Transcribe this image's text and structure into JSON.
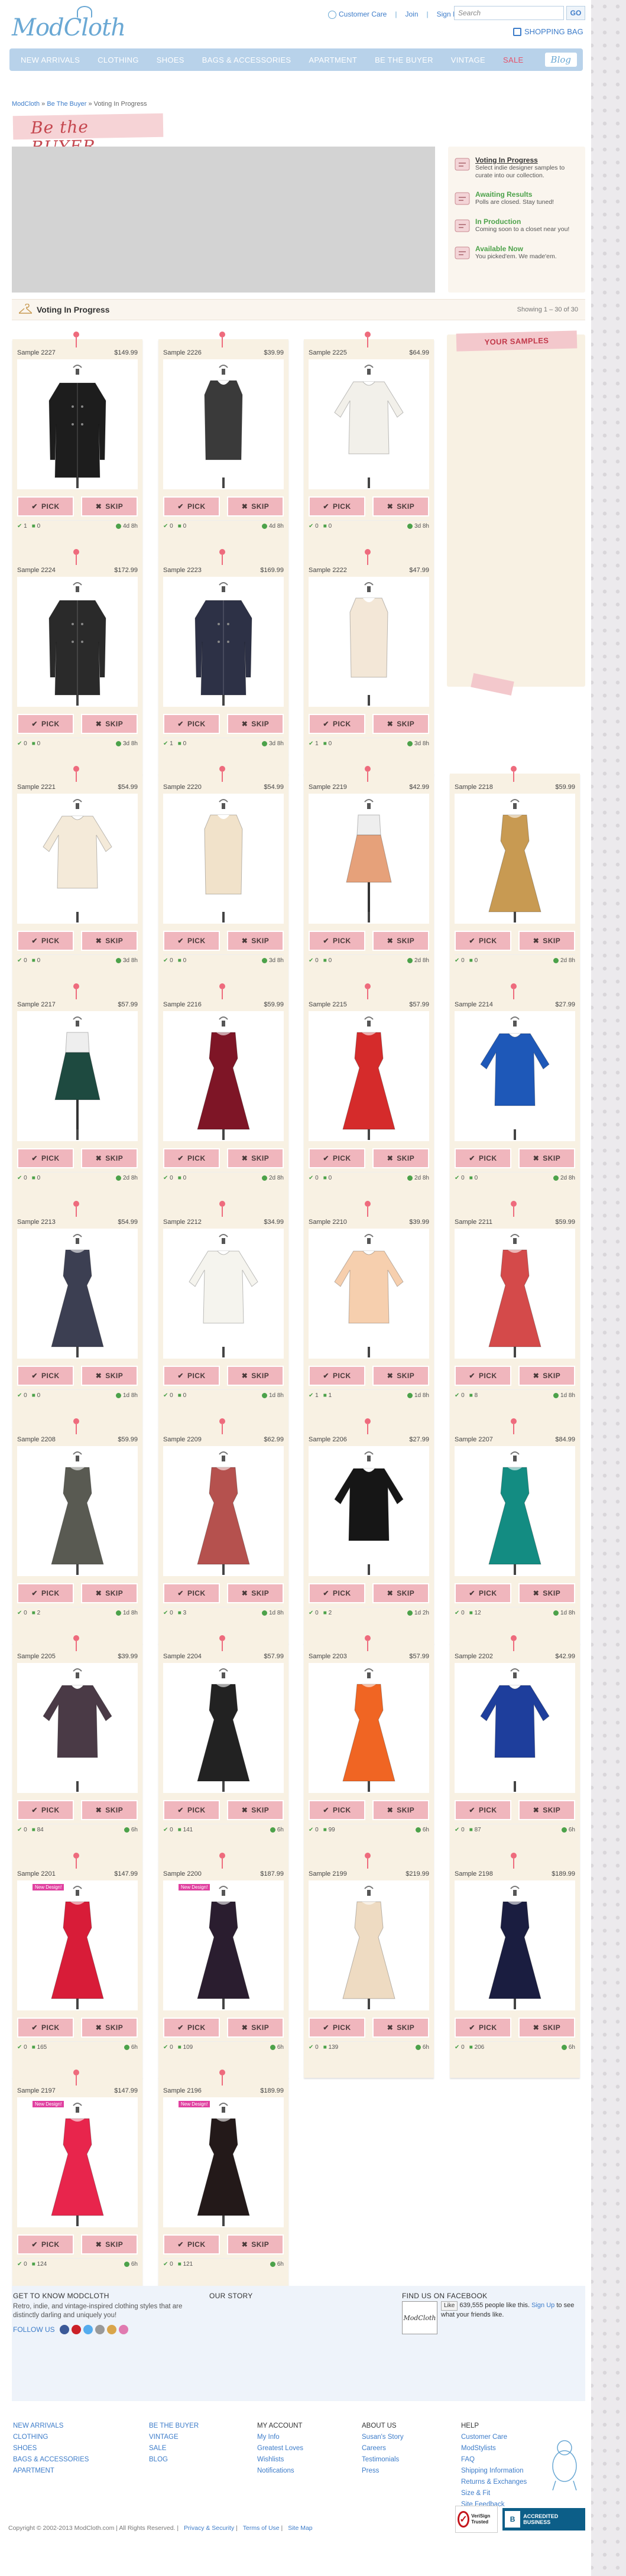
{
  "brand": {
    "logo": "ModCloth"
  },
  "header": {
    "customer_care": "Customer Care",
    "join": "Join",
    "sign_in": "Sign In",
    "search_placeholder": "Search",
    "go": "GO",
    "bag": "SHOPPING BAG"
  },
  "nav": [
    "NEW ARRIVALS",
    "CLOTHING",
    "SHOES",
    "BAGS & ACCESSORIES",
    "APARTMENT",
    "BE THE BUYER",
    "VINTAGE",
    "SALE"
  ],
  "nav_blog": "Blog",
  "breadcrumb": {
    "home": "ModCloth",
    "sep": "»",
    "section": "Be The Buyer",
    "current": "Voting In Progress"
  },
  "page_title": "Be the BUYER",
  "legend": [
    {
      "title": "Voting In Progress",
      "desc": "Select indie designer samples to curate into our collection.",
      "color": "#333"
    },
    {
      "title": "Awaiting Results",
      "desc": "Polls are closed. Stay tuned!",
      "color": "#4ca24a"
    },
    {
      "title": "In Production",
      "desc": "Coming soon to a closet near you!",
      "color": "#4ca24a"
    },
    {
      "title": "Available Now",
      "desc": "You picked'em. We made'em.",
      "color": "#4ca24a"
    }
  ],
  "section": {
    "title": "Voting In Progress",
    "showing": "Showing 1 – 30 of 30"
  },
  "your_samples": "YOUR SAMPLES",
  "buttons": {
    "pick": "PICK",
    "skip": "SKIP"
  },
  "products": [
    {
      "name": "Sample 2227",
      "price": "$149.99",
      "picks": "1",
      "comments": "0",
      "time": "4d 8h",
      "garment": "coat",
      "color": "#1d1d1d"
    },
    {
      "name": "Sample 2226",
      "price": "$39.99",
      "picks": "0",
      "comments": "0",
      "time": "4d 8h",
      "garment": "tank",
      "color": "#3a3a3a"
    },
    {
      "name": "Sample 2225",
      "price": "$64.99",
      "picks": "0",
      "comments": "0",
      "time": "3d 8h",
      "garment": "blouse",
      "color": "#f2f0ea"
    },
    {
      "name": "Sample 2224",
      "price": "$172.99",
      "picks": "0",
      "comments": "0",
      "time": "3d 8h",
      "garment": "coat",
      "color": "#2a2a2a"
    },
    {
      "name": "Sample 2223",
      "price": "$169.99",
      "picks": "1",
      "comments": "0",
      "time": "3d 8h",
      "garment": "coat",
      "color": "#2d3146"
    },
    {
      "name": "Sample 2222",
      "price": "$47.99",
      "picks": "1",
      "comments": "0",
      "time": "3d 8h",
      "garment": "tank",
      "color": "#f3e7d7"
    },
    {
      "name": "Sample 2221",
      "price": "$54.99",
      "picks": "0",
      "comments": "0",
      "time": "3d 8h",
      "garment": "blouse",
      "color": "#f4ead9"
    },
    {
      "name": "Sample 2220",
      "price": "$54.99",
      "picks": "0",
      "comments": "0",
      "time": "3d 8h",
      "garment": "tank",
      "color": "#f1e2ca"
    },
    {
      "name": "Sample 2219",
      "price": "$42.99",
      "picks": "0",
      "comments": "0",
      "time": "2d 8h",
      "garment": "skirt",
      "color": "#e6a17a"
    },
    {
      "name": "Sample 2218",
      "price": "$59.99",
      "picks": "0",
      "comments": "0",
      "time": "2d 8h",
      "garment": "dress",
      "color": "#c89a52"
    },
    {
      "name": "Sample 2217",
      "price": "$57.99",
      "picks": "0",
      "comments": "0",
      "time": "2d 8h",
      "garment": "skirt",
      "color": "#1e4a40"
    },
    {
      "name": "Sample 2216",
      "price": "$59.99",
      "picks": "0",
      "comments": "0",
      "time": "2d 8h",
      "garment": "dress",
      "color": "#7e1526"
    },
    {
      "name": "Sample 2215",
      "price": "$57.99",
      "picks": "0",
      "comments": "0",
      "time": "2d 8h",
      "garment": "dress",
      "color": "#d52b2b"
    },
    {
      "name": "Sample 2214",
      "price": "$27.99",
      "picks": "0",
      "comments": "0",
      "time": "2d 8h",
      "garment": "blouse",
      "color": "#1e58b8"
    },
    {
      "name": "Sample 2213",
      "price": "$54.99",
      "picks": "0",
      "comments": "0",
      "time": "1d 8h",
      "garment": "dress",
      "color": "#3c3f52"
    },
    {
      "name": "Sample 2212",
      "price": "$34.99",
      "picks": "0",
      "comments": "0",
      "time": "1d 8h",
      "garment": "blouse",
      "color": "#f5f4ee"
    },
    {
      "name": "Sample 2210",
      "price": "$39.99",
      "picks": "1",
      "comments": "1",
      "time": "1d 8h",
      "garment": "blouse",
      "color": "#f6cfae"
    },
    {
      "name": "Sample 2211",
      "price": "$59.99",
      "picks": "0",
      "comments": "8",
      "time": "1d 8h",
      "garment": "dress",
      "color": "#d44a4a"
    },
    {
      "name": "Sample 2208",
      "price": "$59.99",
      "picks": "0",
      "comments": "2",
      "time": "1d 8h",
      "garment": "dress",
      "color": "#595a52"
    },
    {
      "name": "Sample 2209",
      "price": "$62.99",
      "picks": "0",
      "comments": "3",
      "time": "1d 8h",
      "garment": "dress",
      "color": "#b5514e"
    },
    {
      "name": "Sample 2206",
      "price": "$27.99",
      "picks": "0",
      "comments": "2",
      "time": "1d 2h",
      "garment": "blouse",
      "color": "#161616"
    },
    {
      "name": "Sample 2207",
      "price": "$84.99",
      "picks": "0",
      "comments": "12",
      "time": "1d 8h",
      "garment": "dress",
      "color": "#138c82"
    },
    {
      "name": "Sample 2205",
      "price": "$39.99",
      "picks": "0",
      "comments": "84",
      "time": "6h",
      "garment": "blouse",
      "color": "#4a3a46"
    },
    {
      "name": "Sample 2204",
      "price": "$57.99",
      "picks": "0",
      "comments": "141",
      "time": "6h",
      "garment": "dress",
      "color": "#222222"
    },
    {
      "name": "Sample 2203",
      "price": "$57.99",
      "picks": "0",
      "comments": "99",
      "time": "6h",
      "garment": "dress",
      "color": "#f06523"
    },
    {
      "name": "Sample 2202",
      "price": "$42.99",
      "picks": "0",
      "comments": "87",
      "time": "6h",
      "garment": "blouse",
      "color": "#1e3e9c"
    },
    {
      "name": "Sample 2201",
      "price": "$147.99",
      "picks": "0",
      "comments": "165",
      "time": "6h",
      "garment": "dress",
      "color": "#d81c38",
      "badge": "New Design!"
    },
    {
      "name": "Sample 2200",
      "price": "$187.99",
      "picks": "0",
      "comments": "109",
      "time": "6h",
      "garment": "dress",
      "color": "#2a1d2f",
      "badge": "New Design!"
    },
    {
      "name": "Sample 2199",
      "price": "$219.99",
      "picks": "0",
      "comments": "139",
      "time": "6h",
      "garment": "dress",
      "color": "#eedbc2"
    },
    {
      "name": "Sample 2198",
      "price": "$189.99",
      "picks": "0",
      "comments": "206",
      "time": "6h",
      "garment": "dress",
      "color": "#1a1d40"
    },
    {
      "name": "Sample 2197",
      "price": "$147.99",
      "picks": "0",
      "comments": "124",
      "time": "6h",
      "garment": "dress",
      "color": "#e8254c",
      "badge": "New Design!"
    },
    {
      "name": "Sample 2196",
      "price": "$189.99",
      "picks": "0",
      "comments": "121",
      "time": "6h",
      "garment": "dress",
      "color": "#231919",
      "badge": "New Design!"
    }
  ],
  "footer": {
    "get_to_know": "GET TO KNOW MODCLOTH",
    "about_text": "Retro, indie, and vintage-inspired clothing styles that are distinctly darling and uniquely you!",
    "follow_us": "FOLLOW US",
    "our_story": "OUR STORY",
    "facebook": "FIND US ON FACEBOOK",
    "fb_like": "Like",
    "fb_count": "639,555 people like this.",
    "fb_signup": "Sign Up",
    "fb_rest": "to see what your friends like.",
    "fb_name": "ModCloth",
    "col1": [
      "NEW ARRIVALS",
      "CLOTHING",
      "SHOES",
      "BAGS & ACCESSORIES",
      "APARTMENT"
    ],
    "col2": [
      "BE THE BUYER",
      "VINTAGE",
      "SALE",
      "BLOG"
    ],
    "col3_title": "MY ACCOUNT",
    "col3": [
      "My Info",
      "Greatest Loves",
      "Wishlists",
      "Notifications"
    ],
    "col4_title": "ABOUT US",
    "col4": [
      "Susan's Story",
      "Careers",
      "Testimonials",
      "Press"
    ],
    "col5_title": "HELP",
    "col5": [
      "Customer Care",
      "ModStylists",
      "FAQ",
      "Shipping Information",
      "Returns & Exchanges",
      "Size & Fit",
      "Site Feedback"
    ],
    "copyright": "Copyright © 2002-2013 ModCloth.com",
    "rights": "All Rights Reserved.",
    "privacy": "Privacy & Security",
    "terms": "Terms of Use",
    "sitemap": "Site Map",
    "verisign": "VeriSign Trusted",
    "bbb": "ACCREDITED BUSINESS"
  }
}
